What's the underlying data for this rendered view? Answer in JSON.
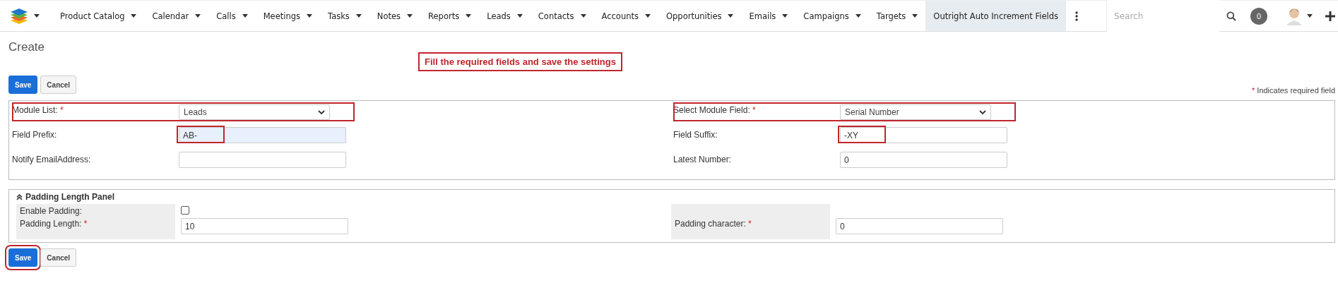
{
  "nav": {
    "items": [
      {
        "label": "Product Catalog",
        "has_menu": true,
        "selected": false
      },
      {
        "label": "Calendar",
        "has_menu": true,
        "selected": false
      },
      {
        "label": "Calls",
        "has_menu": true,
        "selected": false
      },
      {
        "label": "Meetings",
        "has_menu": true,
        "selected": false
      },
      {
        "label": "Tasks",
        "has_menu": true,
        "selected": false
      },
      {
        "label": "Notes",
        "has_menu": true,
        "selected": false
      },
      {
        "label": "Reports",
        "has_menu": true,
        "selected": false
      },
      {
        "label": "Leads",
        "has_menu": true,
        "selected": false
      },
      {
        "label": "Contacts",
        "has_menu": true,
        "selected": false
      },
      {
        "label": "Accounts",
        "has_menu": true,
        "selected": false
      },
      {
        "label": "Opportunities",
        "has_menu": true,
        "selected": false
      },
      {
        "label": "Emails",
        "has_menu": true,
        "selected": false
      },
      {
        "label": "Campaigns",
        "has_menu": true,
        "selected": false
      },
      {
        "label": "Targets",
        "has_menu": true,
        "selected": false
      },
      {
        "label": "Outright Auto Increment Fields",
        "has_menu": false,
        "selected": true
      }
    ],
    "search": {
      "placeholder": "Search"
    },
    "notifications": "0"
  },
  "page_title": "Create",
  "annotation": "Fill the required fields and save the settings",
  "top_buttons": [
    {
      "label": "Save",
      "kind": "primary",
      "highlighted": false
    },
    {
      "label": "Cancel",
      "kind": "secondary",
      "highlighted": false
    }
  ],
  "required_note": {
    "mark": "*",
    "text": "Indicates required field"
  },
  "main_panel": {
    "rows": [
      {
        "left": {
          "label": "Module List:",
          "required": true,
          "kind": "select",
          "value": "Leads",
          "highlighted": true
        },
        "right": {
          "label": "Select Module Field:",
          "required": true,
          "kind": "select",
          "value": "Serial Number",
          "highlighted": true
        }
      },
      {
        "left": {
          "label": "Field Prefix:",
          "required": false,
          "kind": "text",
          "value": "AB-",
          "autofilled": true,
          "highlighted": true
        },
        "right": {
          "label": "Field Suffix:",
          "required": false,
          "kind": "text",
          "value": "-XY",
          "autofilled": false,
          "highlighted": true
        }
      },
      {
        "left": {
          "label": "Notify EmailAddress:",
          "required": false,
          "kind": "text",
          "autofilled": false,
          "highlighted": false
        },
        "right": {
          "label": "Latest Number:",
          "required": false,
          "kind": "text",
          "value": "0",
          "autofilled": false,
          "highlighted": false
        }
      }
    ]
  },
  "padding_panel": {
    "title": "Padding Length Panel",
    "expanded": true,
    "rows": [
      {
        "left": {
          "label": "Enable Padding:",
          "required": false,
          "kind": "checkbox",
          "checked": false
        },
        "right": null
      },
      {
        "left": {
          "label": "Padding Length:",
          "required": true,
          "kind": "text",
          "value": "10",
          "autofilled": false
        },
        "right": {
          "label": "Padding character:",
          "required": true,
          "kind": "text",
          "value": "0",
          "autofilled": false
        }
      }
    ]
  },
  "bottom_buttons": [
    {
      "label": "Save",
      "kind": "primary",
      "highlighted": true
    },
    {
      "label": "Cancel",
      "kind": "secondary",
      "highlighted": false
    }
  ]
}
